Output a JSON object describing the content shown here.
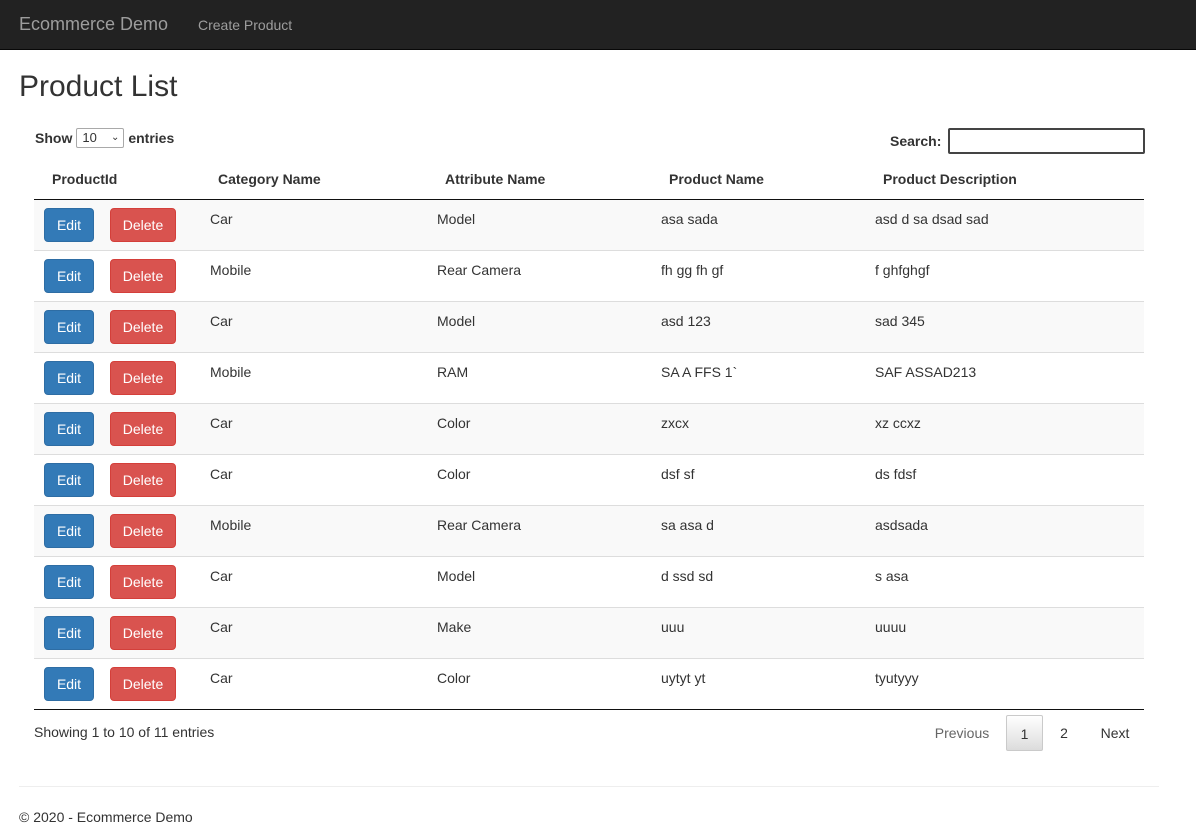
{
  "navbar": {
    "brand": "Ecommerce Demo",
    "links": [
      "Create Product"
    ]
  },
  "page_title": "Product List",
  "length": {
    "prefix": "Show",
    "value": "10",
    "suffix": "entries"
  },
  "search": {
    "label": "Search:",
    "value": ""
  },
  "table": {
    "columns": [
      "ProductId",
      "Category Name",
      "Attribute Name",
      "Product Name",
      "Product Description"
    ],
    "edit_label": "Edit",
    "delete_label": "Delete",
    "rows": [
      [
        "Car",
        "Model",
        "asa sada",
        "asd d sa dsad sad"
      ],
      [
        "Mobile",
        "Rear Camera",
        "fh gg fh gf",
        "f ghfghgf"
      ],
      [
        "Car",
        "Model",
        "asd 123",
        "sad 345"
      ],
      [
        "Mobile",
        "RAM",
        "SA A FFS 1`",
        "SAF ASSAD213"
      ],
      [
        "Car",
        "Color",
        "zxcx",
        "xz ccxz"
      ],
      [
        "Car",
        "Color",
        "dsf sf",
        "ds fdsf"
      ],
      [
        "Mobile",
        "Rear Camera",
        "sa asa d",
        "asdsada"
      ],
      [
        "Car",
        "Model",
        "d ssd sd",
        "s asa"
      ],
      [
        "Car",
        "Make",
        "uuu",
        "uuuu"
      ],
      [
        "Car",
        "Color",
        "uytyt yt",
        "tyutyyy"
      ]
    ]
  },
  "info": "Showing 1 to 10 of 11 entries",
  "pagination": {
    "previous": "Previous",
    "pages": [
      "1",
      "2"
    ],
    "current": "1",
    "next": "Next"
  },
  "footer": "© 2020 - Ecommerce Demo",
  "colors": {
    "navbar": "#222222",
    "edit": "#337ab7",
    "delete": "#d9534f"
  }
}
